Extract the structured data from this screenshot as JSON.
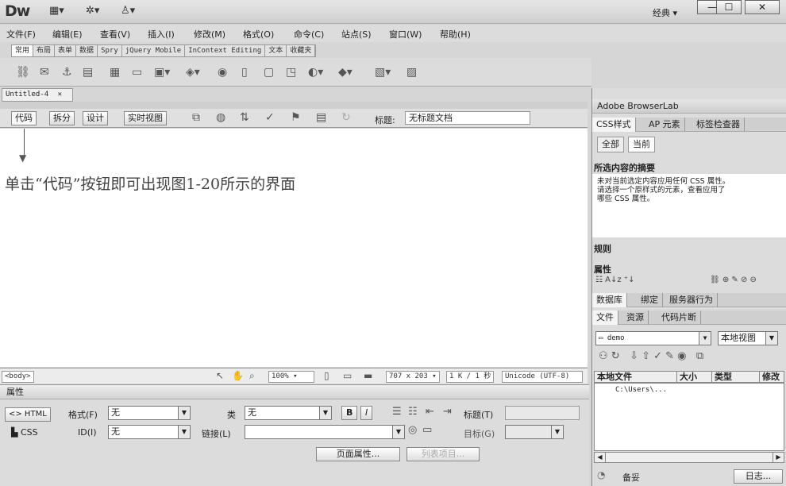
{
  "app": {
    "logo": "Dw",
    "layout_icon": "▦▾",
    "settings_icon": "✲▾",
    "user_icon": "♙▾",
    "workspace": "经典",
    "workspace_arrow": "▾",
    "win_minimize": "—",
    "win_maximize": "☐",
    "win_close": "✕"
  },
  "menu": [
    "文件(F)",
    "编辑(E)",
    "查看(V)",
    "插入(I)",
    "修改(M)",
    "格式(O)",
    "命令(C)",
    "站点(S)",
    "窗口(W)",
    "帮助(H)"
  ],
  "insert_tabs": [
    "常用",
    "布局",
    "表单",
    "数据",
    "Spry",
    "jQuery Mobile",
    "InContext Editing",
    "文本",
    "收藏夹"
  ],
  "document": {
    "tab_title": "Untitled-4",
    "tab_close": "✕",
    "view_buttons": [
      "代码",
      "拆分",
      "设计",
      "实时视图"
    ],
    "title_label": "标题:",
    "title_value": "无标题文档",
    "annotation_arrow": "▼",
    "annotation": "单击“代码”按钮即可出现图1-20所示的界面"
  },
  "status": {
    "tag": "<body>",
    "zoom": "100%",
    "size": "707 x 203",
    "download": "1 K / 1 秒",
    "encoding": "Unicode (UTF-8)"
  },
  "properties": {
    "header": "属性",
    "html_label": "<> HTML",
    "css_label": "CSS",
    "format_label": "格式(F)",
    "format_value": "无",
    "class_label": "类",
    "class_value": "无",
    "id_label": "ID(I)",
    "id_value": "无",
    "link_label": "链接(L)",
    "link_value": "",
    "bold": "B",
    "italic": "I",
    "title_label": "标题(T)",
    "target_label": "目标(G)",
    "page_props_button": "页面属性...",
    "list_item_button": "列表项目..."
  },
  "right_panel": {
    "browserlab": "Adobe BrowserLab",
    "css_tabs": [
      "CSS样式",
      "AP 元素",
      "标签检查器"
    ],
    "css_modes": [
      "全部",
      "当前"
    ],
    "summary_title": "所选内容的摘要",
    "summary_text_1": "未对当前选定内容应用任何 CSS 属性。",
    "summary_text_2": "请选择一个原样式的元素，查看应用了",
    "summary_text_3": "哪些 CSS 属性。",
    "rules": "规则",
    "properties": "属性",
    "db_tabs": [
      "数据库",
      "绑定",
      "服务器行为"
    ],
    "file_tabs": [
      "文件",
      "资源",
      "代码片断"
    ],
    "site_value": "demo",
    "view_value": "本地视图",
    "file_cols": [
      "本地文件",
      "大小",
      "类型",
      "修改"
    ],
    "file_row": "C:\\Users\\...",
    "status_label": "备妥",
    "log_button": "日志..."
  }
}
